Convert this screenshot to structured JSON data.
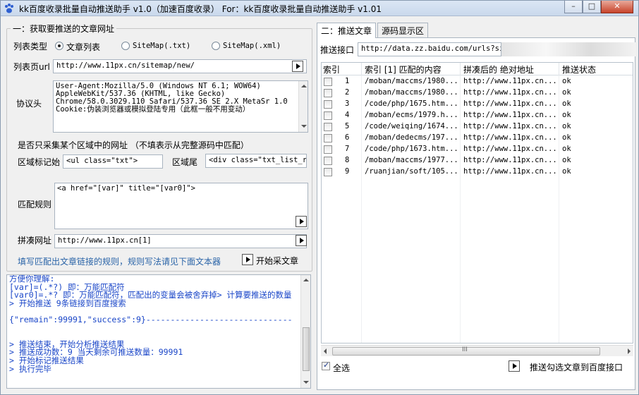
{
  "titlebar": {
    "title": "kk百度收录批量自动推送助手 v1.0（加速百度收录） For：kk百度收录批量自动推送助手 v1.01",
    "minimize_glyph": "–",
    "maximize_glyph": "□",
    "close_glyph": "✕"
  },
  "left": {
    "group_title": "一：获取要推送的文章网址",
    "list_type_label": "列表类型",
    "radio_article_list": "文章列表",
    "radio_sitemap_txt": "SiteMap(.txt)",
    "radio_sitemap_xml": "SiteMap(.xml)",
    "list_page_label": "列表页url",
    "list_page_value": "http://www.11px.cn/sitemap/new/",
    "protocol_label": "协议头",
    "protocol_lines": [
      "User-Agent:Mozilla/5.0 (Windows NT 6.1; WOW64)",
      "AppleWebKit/537.36 (KHTML, like Gecko)",
      "Chrome/58.0.3029.110 Safari/537.36 SE 2.X MetaSr 1.0",
      "Cookie:伪装浏览器或模拟登陆专用（此框一般不用变动）"
    ],
    "region_question": "是否只采集某个区域中的网址 （不填表示从完整源码中匹配）",
    "region_start_label": "区域标记始",
    "region_start_value": "<ul class=\"txt\">",
    "region_end_label": "区域尾",
    "region_end_value": "<div class=\"txt_list_ri",
    "match_rule_label": "匹配规则",
    "match_rule_value": "<a href=\"[var]\" title=\"[var0]\">",
    "concat_label": "拼凑网址",
    "concat_value": "http://www.11px.cn[1]",
    "hint": "填写匹配出文章链接的规则，规则写法请见下面文本器",
    "start_button": "开始采文章",
    "log_lines": [
      "方便你理解:",
      "[var]=(.*?) 即：万能匹配符",
      "[var0]=.*?  即：万能匹配符，匹配出的变量会被舍弃掉> 计算要推送的数量",
      "> 开始推送 9条链接到百度搜索",
      "",
      "{\"remain\":99991,\"success\":9}------------------------------",
      "",
      "",
      "> 推送结束，开始分析推送结果",
      ">     推送成功数：9    当天剩余可推送数量：99991",
      "> 开始标记推送结果",
      "> 执行完毕"
    ]
  },
  "right": {
    "tab_push": "二：推送文章",
    "tab_source": "源码显示区",
    "api_label": "推送接口",
    "api_value": "http://data.zz.baidu.com/urls?site=",
    "columns": [
      "索引",
      "索引 [1] 匹配的内容",
      "拼凑后的 绝对地址",
      "推送状态"
    ],
    "rows": [
      {
        "index": "1",
        "match": "/moban/maccms/1980...",
        "url": "http://www.11px.cn...",
        "status": "ok"
      },
      {
        "index": "2",
        "match": "/moban/maccms/1980...",
        "url": "http://www.11px.cn...",
        "status": "ok"
      },
      {
        "index": "3",
        "match": "/code/php/1675.htm...",
        "url": "http://www.11px.cn...",
        "status": "ok"
      },
      {
        "index": "4",
        "match": "/moban/ecms/1979.h...",
        "url": "http://www.11px.cn...",
        "status": "ok"
      },
      {
        "index": "5",
        "match": "/code/weiqing/1674...",
        "url": "http://www.11px.cn...",
        "status": "ok"
      },
      {
        "index": "6",
        "match": "/moban/dedecms/197...",
        "url": "http://www.11px.cn...",
        "status": "ok"
      },
      {
        "index": "7",
        "match": "/code/php/1673.htm...",
        "url": "http://www.11px.cn...",
        "status": "ok"
      },
      {
        "index": "8",
        "match": "/moban/maccms/1977...",
        "url": "http://www.11px.cn...",
        "status": "ok"
      },
      {
        "index": "9",
        "match": "/ruanjian/soft/105...",
        "url": "http://www.11px.cn...",
        "status": "ok"
      }
    ],
    "select_all_label": "全选",
    "push_button": "推送勾选文章到百度接口",
    "scroll_grip": "III"
  }
}
